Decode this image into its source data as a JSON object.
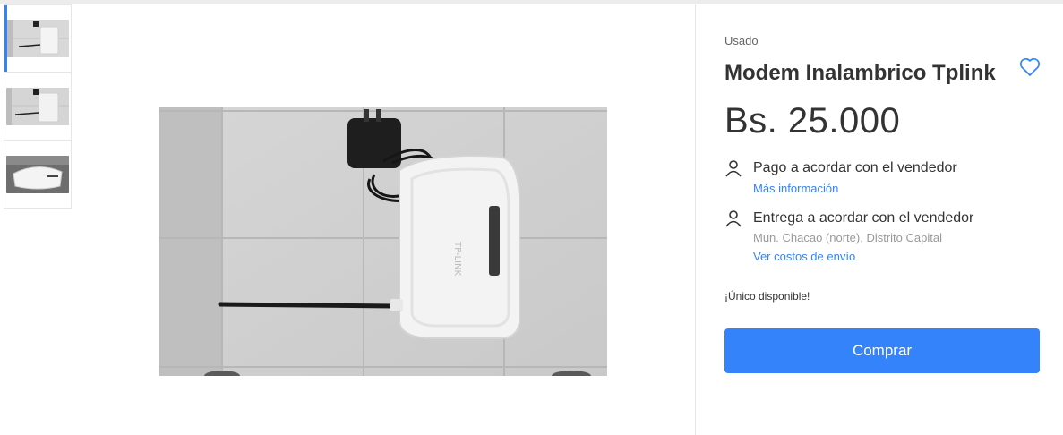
{
  "gallery": {
    "thumbnails": [
      "router-photo-1",
      "router-photo-2",
      "router-photo-3"
    ],
    "selected_index": 0
  },
  "product": {
    "condition": "Usado",
    "title": "Modem Inalambrico Tplink",
    "price": "Bs. 25.000",
    "payment": {
      "label": "Pago a acordar con el vendedor",
      "link": "Más información"
    },
    "delivery": {
      "label": "Entrega a acordar con el vendedor",
      "location": "Mun. Chacao (norte), Distrito Capital",
      "link": "Ver costos de envío"
    },
    "stock_note": "¡Único disponible!",
    "buy_label": "Comprar"
  },
  "colors": {
    "accent": "#3483fa",
    "text": "#333333",
    "muted": "#999999"
  },
  "icons": {
    "favorite": "heart-outline-icon",
    "payment": "person-icon",
    "delivery": "person-icon"
  }
}
